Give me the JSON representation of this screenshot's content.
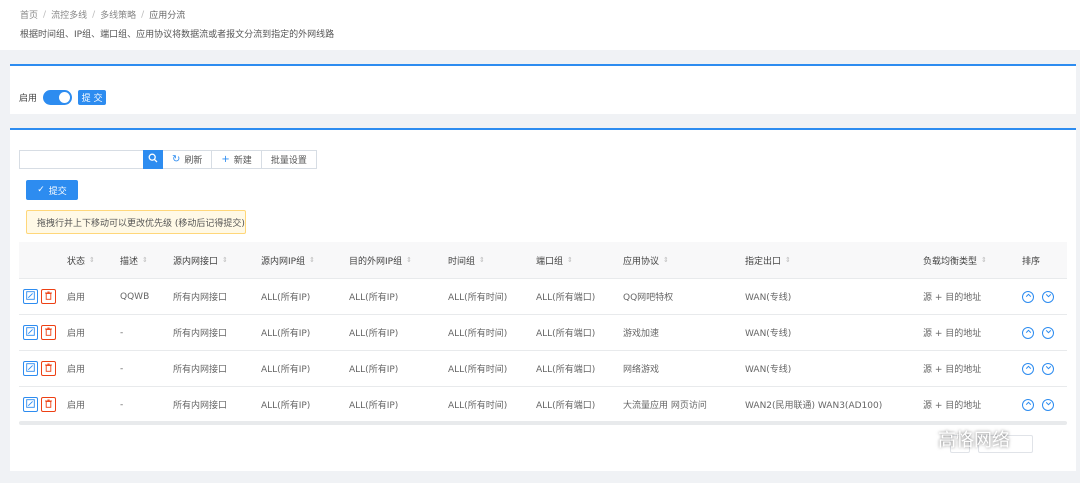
{
  "breadcrumb": [
    "首页",
    "流控多线",
    "多线策略",
    "应用分流"
  ],
  "page_description": "根据时间组、IP组、端口组、应用协议将数据流或者报文分流到指定的外网线路",
  "enable": {
    "label": "启用",
    "on": true,
    "submit_label": "提 交"
  },
  "toolbar": {
    "search_placeholder": "",
    "refresh_label": "刷新",
    "new_label": "新建",
    "batch_label": "批量设置",
    "submit_label": "提交"
  },
  "notice": "拖拽行并上下移动可以更改优先级 (移动后记得提交)",
  "table": {
    "columns": [
      "状态",
      "描述",
      "源内网接口",
      "源内网IP组",
      "目的外网IP组",
      "时间组",
      "端口组",
      "应用协议",
      "指定出口",
      "负载均衡类型",
      "排序"
    ],
    "rows": [
      {
        "status": "启用",
        "desc": "QQWB",
        "src_if": "所有内网接口",
        "src_ip": "ALL(所有IP)",
        "dst_ip": "ALL(所有IP)",
        "time": "ALL(所有时间)",
        "port": "ALL(所有端口)",
        "proto": "QQ网吧特权",
        "out": "WAN(专线)",
        "lb": "源 + 目的地址"
      },
      {
        "status": "启用",
        "desc": "-",
        "src_if": "所有内网接口",
        "src_ip": "ALL(所有IP)",
        "dst_ip": "ALL(所有IP)",
        "time": "ALL(所有时间)",
        "port": "ALL(所有端口)",
        "proto": "游戏加速",
        "out": "WAN(专线)",
        "lb": "源 + 目的地址"
      },
      {
        "status": "启用",
        "desc": "-",
        "src_if": "所有内网接口",
        "src_ip": "ALL(所有IP)",
        "dst_ip": "ALL(所有IP)",
        "time": "ALL(所有时间)",
        "port": "ALL(所有端口)",
        "proto": "网络游戏",
        "out": "WAN(专线)",
        "lb": "源 + 目的地址"
      },
      {
        "status": "启用",
        "desc": "-",
        "src_if": "所有内网接口",
        "src_ip": "ALL(所有IP)",
        "dst_ip": "ALL(所有IP)",
        "time": "ALL(所有时间)",
        "port": "ALL(所有端口)",
        "proto": "大流量应用 网页访问",
        "out": "WAN2(民用联通) WAN3(AD100)",
        "lb": "源 + 目的地址"
      }
    ]
  },
  "watermark": "高恪网络",
  "colors": {
    "primary": "#2d8cf0",
    "danger": "#ed4014",
    "notice_bg": "#fff9e6",
    "notice_border": "#ffd77a"
  },
  "icons": {
    "search": "search-icon",
    "refresh": "refresh-icon",
    "new": "plus-icon",
    "submit": "check-icon",
    "edit": "edit-icon",
    "delete": "trash-icon",
    "up": "chevron-up-icon",
    "down": "chevron-down-icon",
    "wechat": "wechat-icon"
  }
}
